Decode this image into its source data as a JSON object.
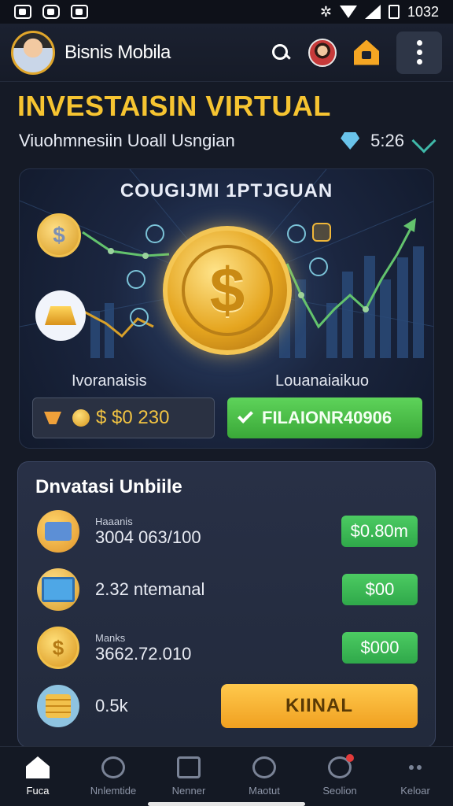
{
  "status_bar": {
    "time": "1032"
  },
  "app_bar": {
    "title": "Bisnis Mobila"
  },
  "hero": {
    "title": "INVESTAISIN VIRTUAL",
    "subtitle": "Viuohmnesiin Uoall Usngian",
    "stat_value": "5:26"
  },
  "banner": {
    "title": "COUGIJMI 1PTJGUAN",
    "small_coin_symbol": "$",
    "big_coin_symbol": "$",
    "left_label": "Ivoranaisis",
    "right_label": "Louanaiaikuo",
    "balance_value": "$ $0 230",
    "action_label": "FILAIONR40906"
  },
  "panel": {
    "title": "Dnvatasi Unbiile",
    "rows": [
      {
        "small": "Haaanis",
        "main": "3004 063/100",
        "pill": "$0.80m"
      },
      {
        "small": "",
        "main": "2.32 ntemanal",
        "pill": "$00"
      },
      {
        "small": "Manks",
        "main": "3662.72.010",
        "pill": "$000"
      },
      {
        "small": "",
        "main": "0.5k",
        "cta": "KIINAL"
      }
    ],
    "dollar_symbol": "$"
  },
  "bottom_nav": {
    "items": [
      {
        "label": "Fuca",
        "icon": "home-icon"
      },
      {
        "label": "Nnlemtide",
        "icon": "clock-icon"
      },
      {
        "label": "Nenner",
        "icon": "card-icon"
      },
      {
        "label": "Maotut",
        "icon": "coin-icon"
      },
      {
        "label": "Seolion",
        "icon": "search-icon"
      },
      {
        "label": "Keloar",
        "icon": "more-icon"
      }
    ]
  },
  "colors": {
    "accent_gold": "#f6c431",
    "accent_green": "#4ccb62",
    "cta_orange": "#f0a020",
    "background": "#151a26"
  }
}
